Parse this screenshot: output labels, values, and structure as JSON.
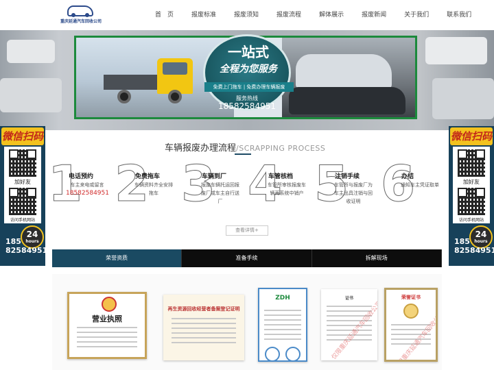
{
  "header": {
    "logo_text": "重庆延通汽车回收公司",
    "nav": [
      "首　页",
      "报废标准",
      "报废须知",
      "报废流程",
      "解体展示",
      "报废新闻",
      "关于我们",
      "联系我们"
    ]
  },
  "banner": {
    "title": "一站式",
    "subtitle": "全程为您服务",
    "ribbon": "免费上门拖车 | 免费办理车辆报废",
    "hotline_label": "服务热线",
    "hotline_number": "18582584951"
  },
  "side_panel": {
    "wechat_title": "微信扫码",
    "qr1_caption": "加好友",
    "qr2_caption": "访问手机网站",
    "badge_number": "24",
    "badge_text": "hours",
    "phone_line1": "185",
    "phone_line2": "82584951"
  },
  "process": {
    "title": "车辆报废办理流程",
    "title_en": "/SCRAPPING PROCESS",
    "steps": [
      {
        "num": "1",
        "title": "电话预约",
        "desc": "车主来电或留言",
        "highlight": "18582584951"
      },
      {
        "num": "2",
        "title": "免费拖车",
        "desc": "车辆资料齐全安排拖车",
        "highlight": ""
      },
      {
        "num": "3",
        "title": "车辆到厂",
        "desc": "报废车辆托运回报废厂或车主自行送厂",
        "highlight": ""
      },
      {
        "num": "4",
        "title": "车管核档",
        "desc": "车管所审核报废车辆再系统中销户",
        "highlight": ""
      },
      {
        "num": "5",
        "title": "注销手续",
        "desc": "车管所与报废厂为车主出具注销与回收证明",
        "highlight": ""
      },
      {
        "num": "6",
        "title": "办结",
        "desc": "通知车主凭证取单",
        "highlight": ""
      }
    ],
    "detail_button": "查看详情+"
  },
  "tabs": [
    "荣誉资质",
    "准备手续",
    "拆解现场"
  ],
  "certificates": {
    "c1_title": "营业执照",
    "c2_title": "再生资源回收经营者备案登记证明",
    "c3_badge": "ZDH",
    "c4_title": "证书",
    "c5_title": "荣誉证书",
    "watermark": "仅限重庆延通汽车回收公司使用"
  },
  "colors": {
    "brand_dark": "#1a4a62",
    "accent_green": "#1c8a3c",
    "accent_red": "#d12b2b"
  }
}
